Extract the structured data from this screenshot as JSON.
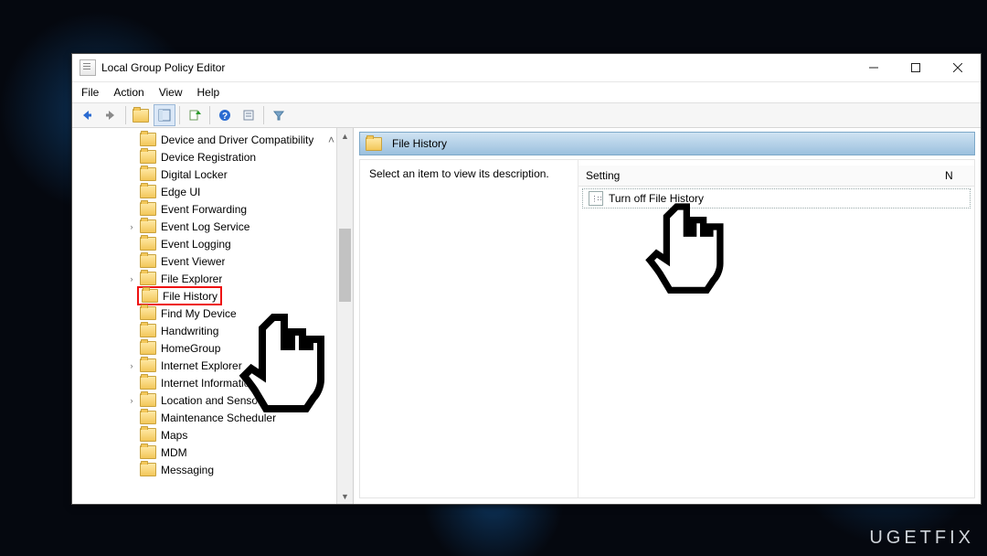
{
  "window": {
    "title": "Local Group Policy Editor"
  },
  "menu": {
    "file": "File",
    "action": "Action",
    "view": "View",
    "help": "Help"
  },
  "tree": {
    "items": [
      {
        "label": "Device and Driver Compatibility",
        "caret": "",
        "truncated": true
      },
      {
        "label": "Device Registration",
        "caret": ""
      },
      {
        "label": "Digital Locker",
        "caret": ""
      },
      {
        "label": "Edge UI",
        "caret": ""
      },
      {
        "label": "Event Forwarding",
        "caret": ""
      },
      {
        "label": "Event Log Service",
        "caret": ">"
      },
      {
        "label": "Event Logging",
        "caret": ""
      },
      {
        "label": "Event Viewer",
        "caret": ""
      },
      {
        "label": "File Explorer",
        "caret": ">"
      },
      {
        "label": "File History",
        "caret": "",
        "selected": true
      },
      {
        "label": "Find My Device",
        "caret": ""
      },
      {
        "label": "Handwriting",
        "caret": ""
      },
      {
        "label": "HomeGroup",
        "caret": ""
      },
      {
        "label": "Internet Explorer",
        "caret": ">"
      },
      {
        "label": "Internet Information Services",
        "caret": ""
      },
      {
        "label": "Location and Sensors",
        "caret": ">"
      },
      {
        "label": "Maintenance Scheduler",
        "caret": ""
      },
      {
        "label": "Maps",
        "caret": ""
      },
      {
        "label": "MDM",
        "caret": ""
      },
      {
        "label": "Messaging",
        "caret": ""
      }
    ]
  },
  "detail": {
    "heading": "File History",
    "description_prompt": "Select an item to view its description.",
    "column_setting": "Setting",
    "column_state_initial": "N",
    "setting_item": "Turn off File History"
  },
  "watermark": "UGETFIX"
}
